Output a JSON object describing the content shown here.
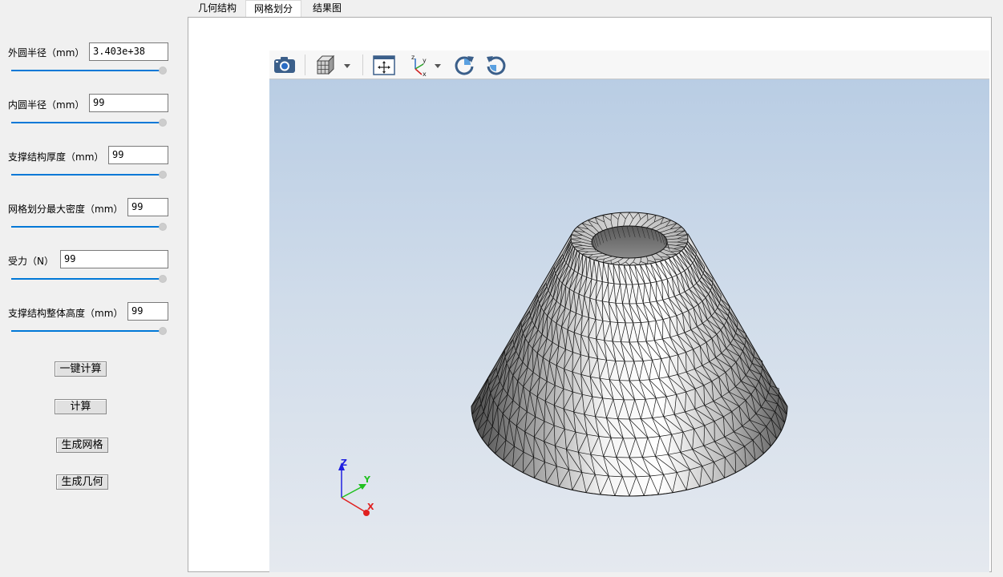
{
  "tabs": [
    {
      "label": "几何结构"
    },
    {
      "label": "网格划分"
    },
    {
      "label": "结果图"
    }
  ],
  "params": [
    {
      "label": "外圆半径（mm）",
      "value": "3.403e+38",
      "slider": 1.0
    },
    {
      "label": "内圆半径（mm）",
      "value": "99",
      "slider": 1.0
    },
    {
      "label": "支撑结构厚度（mm）",
      "value": "99",
      "slider": 1.0
    },
    {
      "label": "网格划分最大密度（mm）",
      "value": "99",
      "slider": 1.0
    },
    {
      "label": "受力（N）",
      "value": "99",
      "slider": 1.0
    },
    {
      "label": "支撑结构整体高度（mm）",
      "value": "99",
      "slider": 1.0
    }
  ],
  "buttons": {
    "one_click": "一键计算",
    "compute": "计算",
    "gen_mesh": "生成网格",
    "gen_geom": "生成几何"
  },
  "axes": {
    "x": "X",
    "y": "Y",
    "z": "Z"
  },
  "toolbar_icons": [
    "camera-icon",
    "view-cube-icon",
    "fit-all-icon",
    "axes-orientation-icon",
    "rotate-cw-icon",
    "rotate-ccw-icon"
  ],
  "colors": {
    "accent": "#0078d7",
    "axis_x": "#e02020",
    "axis_y": "#20c020",
    "axis_z": "#2020e0"
  }
}
